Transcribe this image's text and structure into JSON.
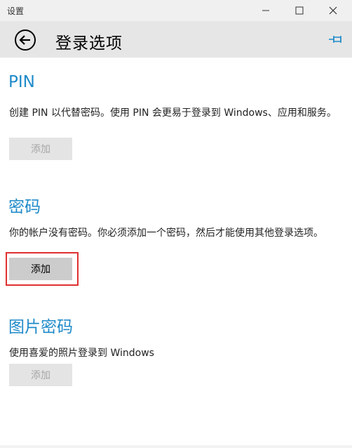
{
  "window": {
    "title": "设置"
  },
  "header": {
    "title": "登录选项"
  },
  "sections": {
    "pin": {
      "title": "PIN",
      "description": "创建 PIN 以代替密码。使用 PIN 会更易于登录到 Windows、应用和服务。",
      "button_label": "添加"
    },
    "password": {
      "title": "密码",
      "description": "你的帐户没有密码。你必须添加一个密码，然后才能使用其他登录选项。",
      "button_label": "添加"
    },
    "picture_password": {
      "title": "图片密码",
      "description": "使用喜爱的照片登录到 Windows",
      "button_label": "添加"
    }
  },
  "colors": {
    "accent": "#1f8ac9",
    "highlight": "#e03030"
  }
}
